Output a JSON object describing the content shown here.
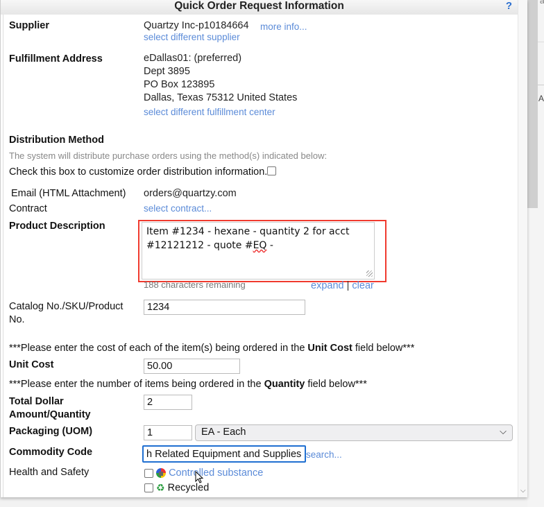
{
  "dialog": {
    "title": "Quick Order Request Information",
    "help_label": "?"
  },
  "background": {
    "partial_text_top": "ar",
    "partial_text": "Ac"
  },
  "supplier": {
    "label": "Supplier",
    "value": "Quartzy Inc-p10184664",
    "more_info_link": "more info...",
    "select_different_link": "select different supplier"
  },
  "fulfillment": {
    "label": "Fulfillment Address",
    "lines": [
      "eDallas01: (preferred)",
      "Dept 3895",
      "PO Box 123895",
      "Dallas, Texas 75312 United States"
    ],
    "select_different_link": "select different fulfillment center"
  },
  "distribution": {
    "label": "Distribution Method",
    "note": "The system will distribute purchase orders using the method(s) indicated below:",
    "customize_label": "Check this box to customize order distribution information.",
    "customize_checked": false,
    "method_label": "Email (HTML Attachment)",
    "method_value": "orders@quartzy.com"
  },
  "contract": {
    "label": "Contract",
    "select_link": "select contract..."
  },
  "product_description": {
    "label": "Product Description",
    "value_part1": "Item #1234 - hexane - quantity 2 for acct #12121212 - quote #",
    "value_misspelled": "EQ",
    "value_part2": " -",
    "chars_remaining": "188 characters remaining",
    "expand_link": "expand",
    "separator": "|",
    "clear_link": "clear"
  },
  "catalog": {
    "label": "Catalog No./SKU/Product No.",
    "value": "1234"
  },
  "unit_cost_note": {
    "prefix": "***Please enter the cost of each of the item(s) being ordered in the ",
    "bold": "Unit Cost",
    "suffix": " field below***"
  },
  "unit_cost": {
    "label": "Unit Cost",
    "value": "50.00"
  },
  "quantity_note": {
    "prefix": "***Please enter the number of items being ordered in the ",
    "bold": "Quantity",
    "suffix": " field below***"
  },
  "quantity": {
    "label": "Total Dollar Amount/Quantity",
    "value": "2"
  },
  "packaging": {
    "label": "Packaging (UOM)",
    "value": "1",
    "uom_selected": "EA - Each"
  },
  "commodity": {
    "label": "Commodity Code",
    "value": "h Related Equipment and Supplies",
    "search_link": "search..."
  },
  "health_safety": {
    "label": "Health and Safety",
    "options": [
      {
        "label": "Controlled substance",
        "icon": "controlled-substance-icon",
        "checked": false,
        "is_link": true
      },
      {
        "label": "Recycled",
        "icon": "recycle-icon",
        "checked": false,
        "is_link": false
      }
    ]
  }
}
